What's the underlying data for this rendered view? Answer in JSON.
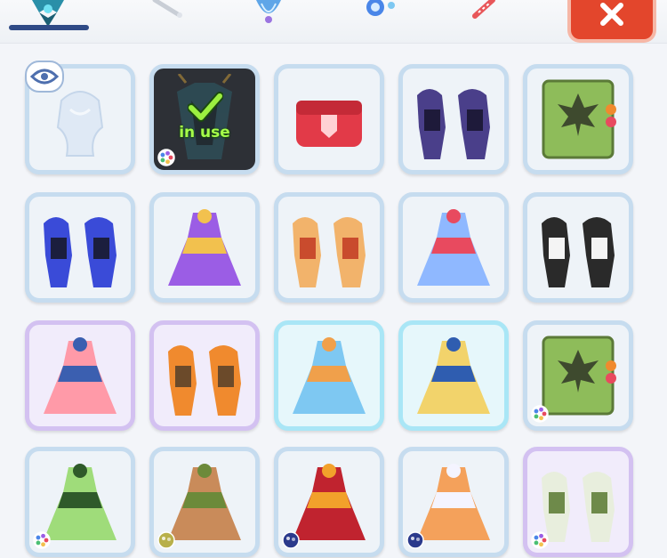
{
  "tabs": [
    {
      "name": "tab-character",
      "icon": "character-icon"
    },
    {
      "name": "tab-wand",
      "icon": "wand-icon"
    },
    {
      "name": "tab-shell",
      "icon": "shell-icon"
    },
    {
      "name": "tab-candy",
      "icon": "candy-icon"
    },
    {
      "name": "tab-stick",
      "icon": "stick-icon"
    }
  ],
  "close_button": {
    "icon": "close-icon"
  },
  "in_use_label": "in use",
  "outfits": [
    {
      "name": "outfit-invisible",
      "frame": "blue",
      "art": "ghost",
      "colors": [
        "#dfe9f5",
        "#f4f8fc"
      ],
      "badge": "eye-icon"
    },
    {
      "name": "outfit-dark-armor",
      "frame": "dark",
      "art": "armor",
      "colors": [
        "#2f5f6a",
        "#1a2a30"
      ],
      "state": "in-use",
      "palette": "rainbow"
    },
    {
      "name": "outfit-red-chest",
      "frame": "blue",
      "art": "chest",
      "colors": [
        "#e23a48",
        "#ffd1d4"
      ]
    },
    {
      "name": "outfit-purple-warriors",
      "frame": "blue",
      "art": "pair",
      "colors": [
        "#4a3f8a",
        "#1e1a3a"
      ]
    },
    {
      "name": "outfit-green-book-leaf",
      "frame": "blue",
      "art": "book",
      "colors": [
        "#8ebc5a",
        "#3e4a2e"
      ]
    },
    {
      "name": "outfit-blue-armor",
      "frame": "blue",
      "art": "pair",
      "colors": [
        "#3a4bd8",
        "#1b1e3e"
      ]
    },
    {
      "name": "outfit-purple-gown",
      "frame": "blue",
      "art": "dress",
      "colors": [
        "#9b5de5",
        "#f2c14e"
      ]
    },
    {
      "name": "outfit-lion-suits",
      "frame": "blue",
      "art": "pair",
      "colors": [
        "#f2b36b",
        "#c94b2d"
      ]
    },
    {
      "name": "outfit-ice-princess",
      "frame": "blue",
      "art": "dress",
      "colors": [
        "#8fb8ff",
        "#e84a5f"
      ]
    },
    {
      "name": "outfit-maid",
      "frame": "blue",
      "art": "pair",
      "colors": [
        "#2a2a2a",
        "#f4f4f4"
      ]
    },
    {
      "name": "outfit-pink-dress",
      "frame": "purple",
      "art": "dress",
      "colors": [
        "#ff9aa8",
        "#3b5fb0"
      ]
    },
    {
      "name": "outfit-orange-ranger",
      "frame": "purple",
      "art": "pair",
      "colors": [
        "#f08a2e",
        "#6b4a2a"
      ]
    },
    {
      "name": "outfit-ocean-gown",
      "frame": "cyan",
      "art": "dress",
      "colors": [
        "#7ec8f2",
        "#f0a04b"
      ]
    },
    {
      "name": "outfit-tropical",
      "frame": "cyan",
      "art": "dress",
      "colors": [
        "#f2d36b",
        "#2f5db0"
      ]
    },
    {
      "name": "outfit-green-book-bag",
      "frame": "blue",
      "art": "book",
      "colors": [
        "#8ebc5a",
        "#3e4a2e"
      ],
      "palette": "rainbow"
    },
    {
      "name": "outfit-green-gown",
      "frame": "blue",
      "art": "dress",
      "colors": [
        "#9fdc7a",
        "#2f5a2a"
      ],
      "palette": "rainbow"
    },
    {
      "name": "outfit-forest-dress",
      "frame": "blue",
      "art": "dress",
      "colors": [
        "#c98b5a",
        "#6c8a3a"
      ],
      "palette": "olive"
    },
    {
      "name": "outfit-fire-dress",
      "frame": "blue",
      "art": "dress",
      "colors": [
        "#c0232f",
        "#f2a12b"
      ],
      "palette": "navy"
    },
    {
      "name": "outfit-sunset-gown",
      "frame": "blue",
      "art": "dress",
      "colors": [
        "#f4a15b",
        "#f4f4ff"
      ],
      "palette": "navy"
    },
    {
      "name": "outfit-white-botanic",
      "frame": "purple",
      "art": "pair",
      "colors": [
        "#e8eedd",
        "#6e8a4a"
      ],
      "palette": "rainbow"
    }
  ]
}
